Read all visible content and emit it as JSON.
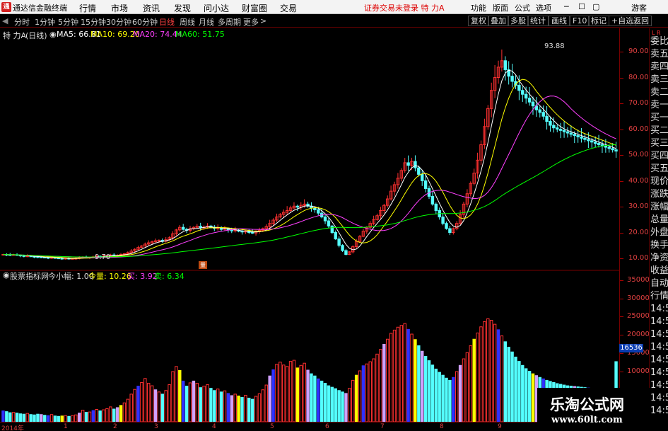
{
  "titlebar": {
    "logo_char": "通",
    "title": "通达信金融终端",
    "menus": [
      "行情",
      "市场",
      "资讯",
      "发现",
      "问小达",
      "财富圈",
      "交易"
    ],
    "alert": "证券交易未登录  特 力A",
    "right_menus": [
      "功能",
      "版面",
      "公式",
      "选项"
    ],
    "guest": "游客"
  },
  "toolbar": {
    "periods": [
      "分时",
      "1分钟",
      "5分钟",
      "15分钟",
      "30分钟",
      "60分钟",
      "日线",
      "周线",
      "月线",
      "多周期",
      "更多"
    ],
    "active_period": "日线",
    "right_buttons": [
      "复权",
      "叠加",
      "多股",
      "统计",
      "画线",
      "F10",
      "标记",
      "+自选",
      "返回"
    ]
  },
  "info": {
    "stock": "特 力A",
    "period": "(日线)",
    "ma5": "MA5: 66.81",
    "ma10": "MA10: 69.20",
    "ma20": "MA20: 74.44",
    "ma60": "MA60: 51.75"
  },
  "colors": {
    "ma5": "#ffffff",
    "ma10": "#ffff00",
    "ma20": "#ff40ff",
    "ma60": "#00ff00",
    "up": "#ff3030",
    "down": "#54ffff",
    "accent": "#e04040"
  },
  "sidebar": {
    "flag": "L R",
    "items": [
      "委比",
      "卖五",
      "卖四",
      "卖三",
      "卖二",
      "卖一",
      "买一",
      "买二",
      "买三",
      "买四",
      "买五",
      "现价",
      "涨跌",
      "涨幅",
      "总量",
      "外盘",
      "换手",
      "净资",
      "收益",
      "自动",
      "行情",
      "14:5",
      "14:5",
      "14:5",
      "14:5",
      "14:5",
      "14:5",
      "14:5",
      "14:5",
      "14:5"
    ]
  },
  "price_axis": [
    "90.00",
    "80.00",
    "70.00",
    "60.00",
    "50.00",
    "40.00",
    "30.00",
    "20.00",
    "10.00"
  ],
  "volume_axis": [
    "35000",
    "30000",
    "25000",
    "20000",
    "15000",
    "10000"
  ],
  "current_volume": "16536",
  "annotations": {
    "high": "93.88",
    "low": "9.70",
    "marker": "量"
  },
  "volume_header": {
    "name": "股票指标网",
    "today": "今小幅: 1.00",
    "vol": "今量: 10.26",
    "buy": "买: 3.92",
    "sell": "卖: 6.34"
  },
  "xaxis": [
    "2014年",
    "1",
    "2",
    "3",
    "4",
    "5",
    "6",
    "7",
    "8",
    "9"
  ],
  "watermark": {
    "line1": "乐淘公式网",
    "line2": "www.60lt.com"
  },
  "chart_data": {
    "type": "candlestick",
    "x": [
      1,
      2,
      3,
      4,
      5,
      6,
      7,
      8,
      9,
      10,
      11,
      12,
      13,
      14,
      15,
      16,
      17,
      18,
      19,
      20,
      21,
      22,
      23,
      24,
      25,
      26,
      27,
      28,
      29,
      30,
      31,
      32,
      33,
      34,
      35,
      36,
      37,
      38,
      39,
      40,
      41,
      42,
      43,
      44,
      45,
      46,
      47,
      48,
      49,
      50,
      51,
      52,
      53,
      54,
      55,
      56,
      57,
      58,
      59,
      60,
      61,
      62,
      63,
      64,
      65,
      66,
      67,
      68,
      69,
      70,
      71,
      72,
      73,
      74,
      75,
      76,
      77,
      78,
      79,
      80,
      81,
      82,
      83,
      84,
      85,
      86,
      87,
      88,
      89,
      90,
      91,
      92,
      93,
      94,
      95,
      96,
      97,
      98,
      99,
      100,
      101,
      102,
      103,
      104,
      105,
      106,
      107,
      108,
      109,
      110,
      111,
      112,
      113,
      114,
      115,
      116,
      117,
      118,
      119,
      120,
      121,
      122,
      123,
      124,
      125,
      126,
      127,
      128,
      129,
      130,
      131,
      132,
      133,
      134,
      135,
      136,
      137,
      138,
      139,
      140,
      141,
      142,
      143,
      144,
      145,
      146,
      147,
      148,
      149,
      150,
      151,
      152,
      153,
      154,
      155,
      156,
      157,
      158,
      159,
      160,
      161,
      162,
      163,
      164,
      165,
      166,
      167,
      168,
      169,
      170,
      171,
      172,
      173,
      174,
      175,
      176,
      177,
      178,
      179,
      180
    ],
    "close": [
      11.5,
      11.4,
      11.3,
      11.4,
      11.2,
      11.0,
      10.8,
      10.9,
      10.7,
      10.6,
      10.5,
      10.4,
      10.3,
      10.2,
      10.3,
      10.1,
      10.0,
      9.9,
      10.0,
      9.8,
      9.9,
      10.0,
      10.2,
      10.5,
      10.3,
      10.4,
      10.6,
      10.8,
      10.7,
      10.9,
      11.1,
      11.3,
      11.0,
      11.2,
      11.5,
      11.8,
      12.2,
      12.8,
      13.5,
      14.2,
      14.8,
      15.5,
      16.0,
      16.4,
      16.8,
      17.0,
      16.6,
      17.2,
      18.0,
      19.5,
      21.0,
      22.0,
      21.2,
      20.8,
      21.5,
      22.0,
      22.4,
      21.8,
      22.1,
      22.5,
      22.0,
      21.6,
      21.8,
      21.2,
      21.5,
      21.0,
      20.6,
      20.9,
      20.5,
      20.2,
      20.6,
      20.0,
      19.8,
      20.3,
      20.8,
      21.5,
      22.3,
      23.5,
      24.8,
      26.0,
      27.0,
      27.8,
      28.5,
      29.5,
      30.2,
      29.8,
      30.5,
      31.0,
      30.2,
      29.5,
      28.8,
      27.5,
      26.0,
      24.5,
      22.5,
      20.0,
      17.5,
      15.0,
      13.0,
      11.5,
      12.5,
      14.5,
      16.5,
      18.5,
      20.5,
      22.0,
      23.5,
      25.0,
      26.5,
      28.5,
      30.5,
      33.0,
      36.0,
      38.5,
      41.0,
      44.0,
      47.0,
      46.0,
      47.5,
      45.0,
      42.5,
      40.0,
      37.0,
      34.0,
      31.0,
      28.5,
      26.0,
      23.5,
      21.5,
      20.0,
      21.5,
      23.5,
      27.0,
      31.0,
      35.0,
      39.0,
      43.0,
      48.0,
      54.0,
      61.0,
      68.0,
      75.0,
      80.0,
      84.0,
      86.5,
      83.0,
      80.5,
      78.5,
      77.0,
      75.0,
      73.5,
      72.0,
      70.5,
      69.0,
      67.5,
      66.5,
      65.0,
      63.0,
      61.5,
      60.5,
      60.0,
      59.5,
      59.0,
      58.5,
      58.0,
      57.5,
      57.0,
      56.5,
      56.0,
      55.5,
      55.0,
      54.5,
      54.0,
      53.5,
      53.0,
      52.5,
      52.0,
      51.5
    ],
    "volume": [
      3000,
      2800,
      2500,
      2600,
      2400,
      2200,
      2100,
      2300,
      2000,
      1900,
      2100,
      2000,
      1800,
      1700,
      2000,
      1600,
      1500,
      1600,
      1700,
      1500,
      1700,
      1900,
      2400,
      3200,
      2600,
      2700,
      3100,
      3400,
      3000,
      3300,
      3600,
      4100,
      3500,
      3900,
      4500,
      5200,
      6200,
      7600,
      8900,
      9800,
      10800,
      11900,
      10600,
      9900,
      8800,
      8200,
      7600,
      8600,
      10200,
      13800,
      15200,
      14100,
      11200,
      9800,
      10700,
      11200,
      10600,
      9400,
      9800,
      10200,
      9200,
      8600,
      9000,
      8200,
      8500,
      7800,
      7200,
      7600,
      7100,
      6700,
      7300,
      6500,
      6200,
      7000,
      7700,
      8800,
      10100,
      12600,
      14300,
      15800,
      16400,
      15600,
      15200,
      16600,
      16900,
      14800,
      15500,
      16100,
      14200,
      13200,
      12600,
      11800,
      11200,
      10600,
      9900,
      9500,
      9100,
      8600,
      8200,
      7800,
      9200,
      11400,
      12800,
      14000,
      15400,
      15900,
      16500,
      17300,
      18600,
      19900,
      21300,
      22700,
      24300,
      25200,
      26000,
      26500,
      27000,
      25400,
      24100,
      22600,
      20900,
      19400,
      18000,
      16800,
      15600,
      14500,
      13600,
      12800,
      12000,
      11400,
      12200,
      13800,
      15500,
      17300,
      19000,
      20900,
      22700,
      24400,
      26100,
      27500,
      28300,
      27900,
      26800,
      25300,
      23600,
      22000,
      20500,
      19200,
      17800,
      16600,
      15500,
      14600,
      13900,
      13200,
      12700,
      12200,
      11800,
      11400,
      11100,
      10800,
      10500,
      10300,
      10100,
      9900,
      9800,
      9700,
      9600,
      9500,
      9400,
      9300,
      9200,
      9100,
      9000,
      8900,
      8800,
      8700,
      8600,
      16536
    ],
    "title": "特 力A (日线)",
    "ylim": [
      5,
      98
    ]
  }
}
